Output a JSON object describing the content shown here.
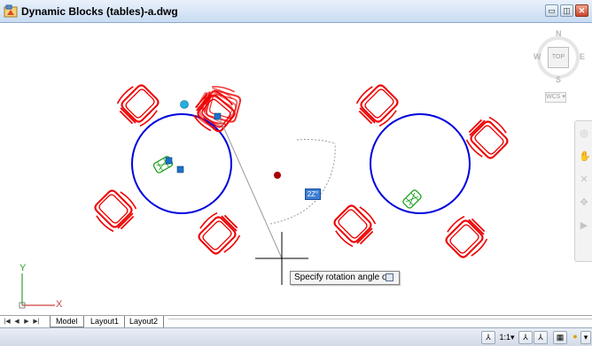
{
  "window": {
    "title": "Dynamic Blocks (tables)-a.dwg",
    "buttons": {
      "minimize": "▭",
      "restore": "◫",
      "close": "✕"
    }
  },
  "viewcube": {
    "north": "N",
    "south": "S",
    "east": "E",
    "west": "W",
    "face": "TOP",
    "wcs_label": "WCS ▾"
  },
  "drawing": {
    "colors": {
      "chair": "#ee0000",
      "table": "#0000dd",
      "grip": "#1a72c8",
      "grip_cyan": "#22b0e0",
      "phone": "#1ea01e",
      "rotation_point": "#aa0000",
      "guide": "#9a9a9a"
    }
  },
  "command": {
    "tooltip": "Specify rotation angle or",
    "dynamic_input": "2Z°"
  },
  "ucs": {
    "x_label": "X",
    "y_label": "Y"
  },
  "layout_tabs": {
    "nav": [
      "|◀",
      "◀",
      "▶",
      "▶|"
    ],
    "tabs": [
      {
        "label": "Model",
        "active": true
      },
      {
        "label": "Layout1",
        "active": false
      },
      {
        "label": "Layout2",
        "active": false
      }
    ]
  },
  "statusbar": {
    "annotation_scale": "1:1▾"
  }
}
